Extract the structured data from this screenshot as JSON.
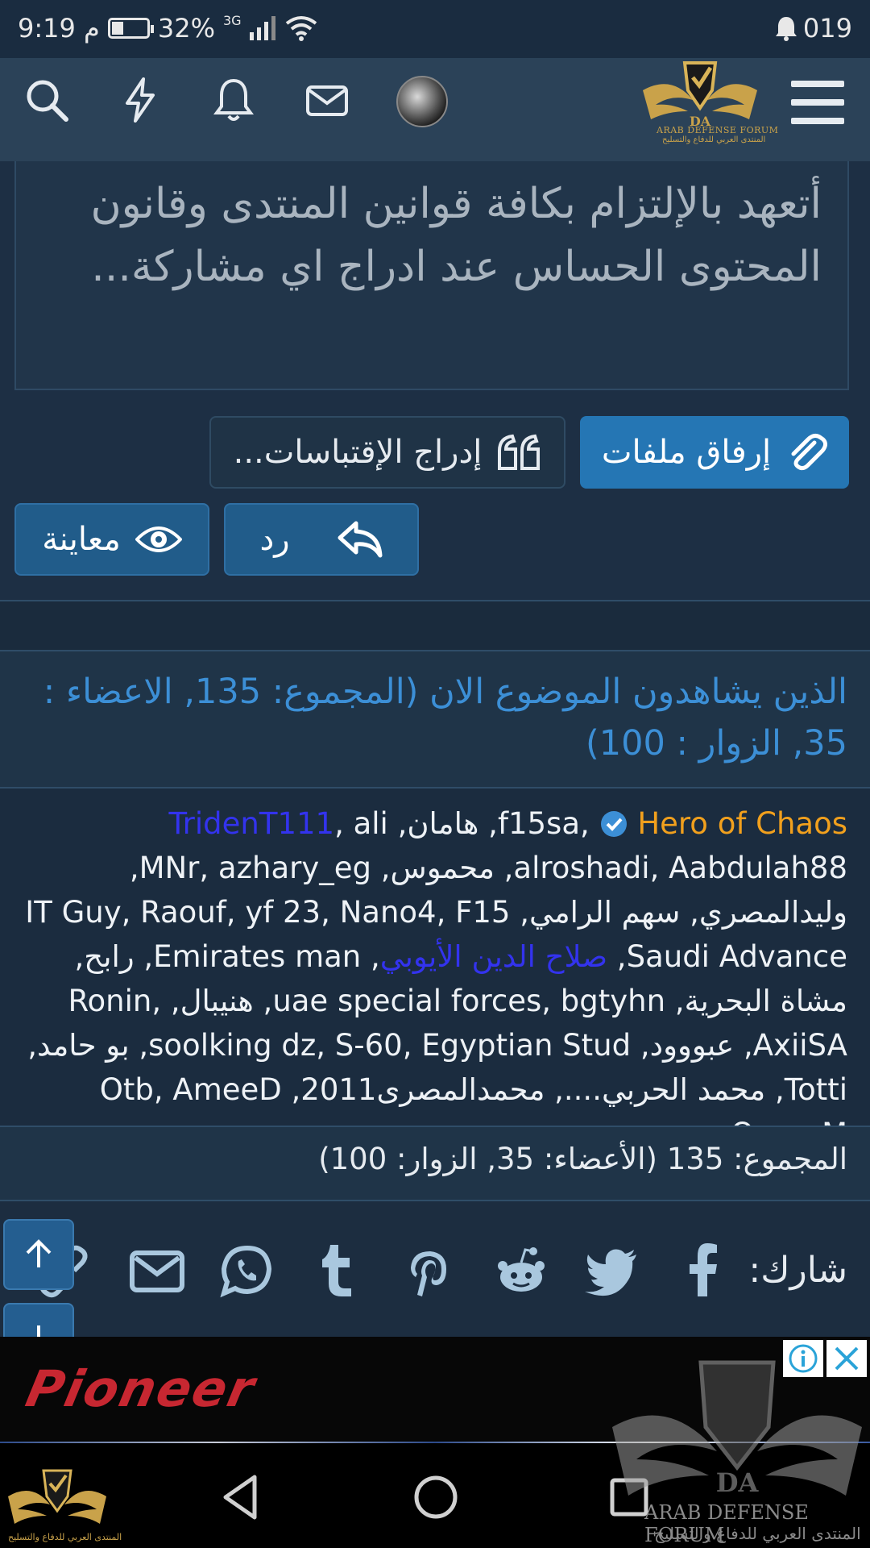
{
  "status_bar": {
    "time": "9:19 م",
    "battery_percent": "32%",
    "battery_level": 0.32,
    "network": "3G",
    "notification_count": "019"
  },
  "header": {
    "logo_title": "ARAB DEFENSE FORUM",
    "logo_subtitle": "المنتدى العربي للدفاع والتسليح",
    "logo_letters": "DA"
  },
  "editor": {
    "placeholder_text": "أتعهد بالإلتزام بكافة قوانين المنتدى وقانون المحتوى الحساس عند ادراج اي مشاركة..."
  },
  "buttons": {
    "attach_files": "إرفاق ملفات",
    "insert_quotes": "إدراج الإقتباسات...",
    "reply": "رد",
    "preview": "معاينة"
  },
  "viewers": {
    "heading": "الذين يشاهدون الموضوع الان (المجموع: 135, الاعضاء : 35, الزوار : 100)",
    "users_segments": [
      {
        "text": "f15sa, ",
        "style": "normal"
      },
      {
        "text": "Hero of Chaos",
        "style": "gold"
      },
      {
        "text": ", هامان, ",
        "style": "normal"
      },
      {
        "text": "TridenT111",
        "style": "blue"
      },
      {
        "text": ", ali alroshadi, Aabdulah88, محموس, MNr, azhary_eg, وليدالمصري, سهم الرامي, IT Guy, Raouf, yf 23, Nano4, F15 Saudi Advance, ",
        "style": "normal"
      },
      {
        "text": "صلاح الدين الأيوبي",
        "style": "blue"
      },
      {
        "text": ", Emirates man, رابح, مشاة البحرية, uae special forces, bgtyhn, هنيبال, Ronin, AxiiSA, عبووود, soolking dz, S-60, Egyptian Stud, بو حامد, Totti, محمد الحربي...., محمدالمصرى2011, Otb, AmeeD QassaM",
        "style": "normal"
      }
    ],
    "total": "المجموع: 135 (الأعضاء: 35, الزوار: 100)"
  },
  "share": {
    "label": "شارك:",
    "icons": [
      "facebook-icon",
      "twitter-icon",
      "reddit-icon",
      "pinterest-icon",
      "tumblr-icon",
      "whatsapp-icon",
      "email-icon",
      "link-icon"
    ]
  },
  "ad": {
    "brand_text": "Pioneer"
  },
  "watermark": {
    "title": "ARAB DEFENSE FORUM",
    "subtitle": "المنتدى العربي للدفاع والتسليح"
  },
  "colors": {
    "accent_blue": "#2576b4",
    "heading_blue": "#3c8fd6",
    "gold_user": "#f1a01d",
    "blue_user": "#3333ee",
    "background": "#1d2f44"
  }
}
